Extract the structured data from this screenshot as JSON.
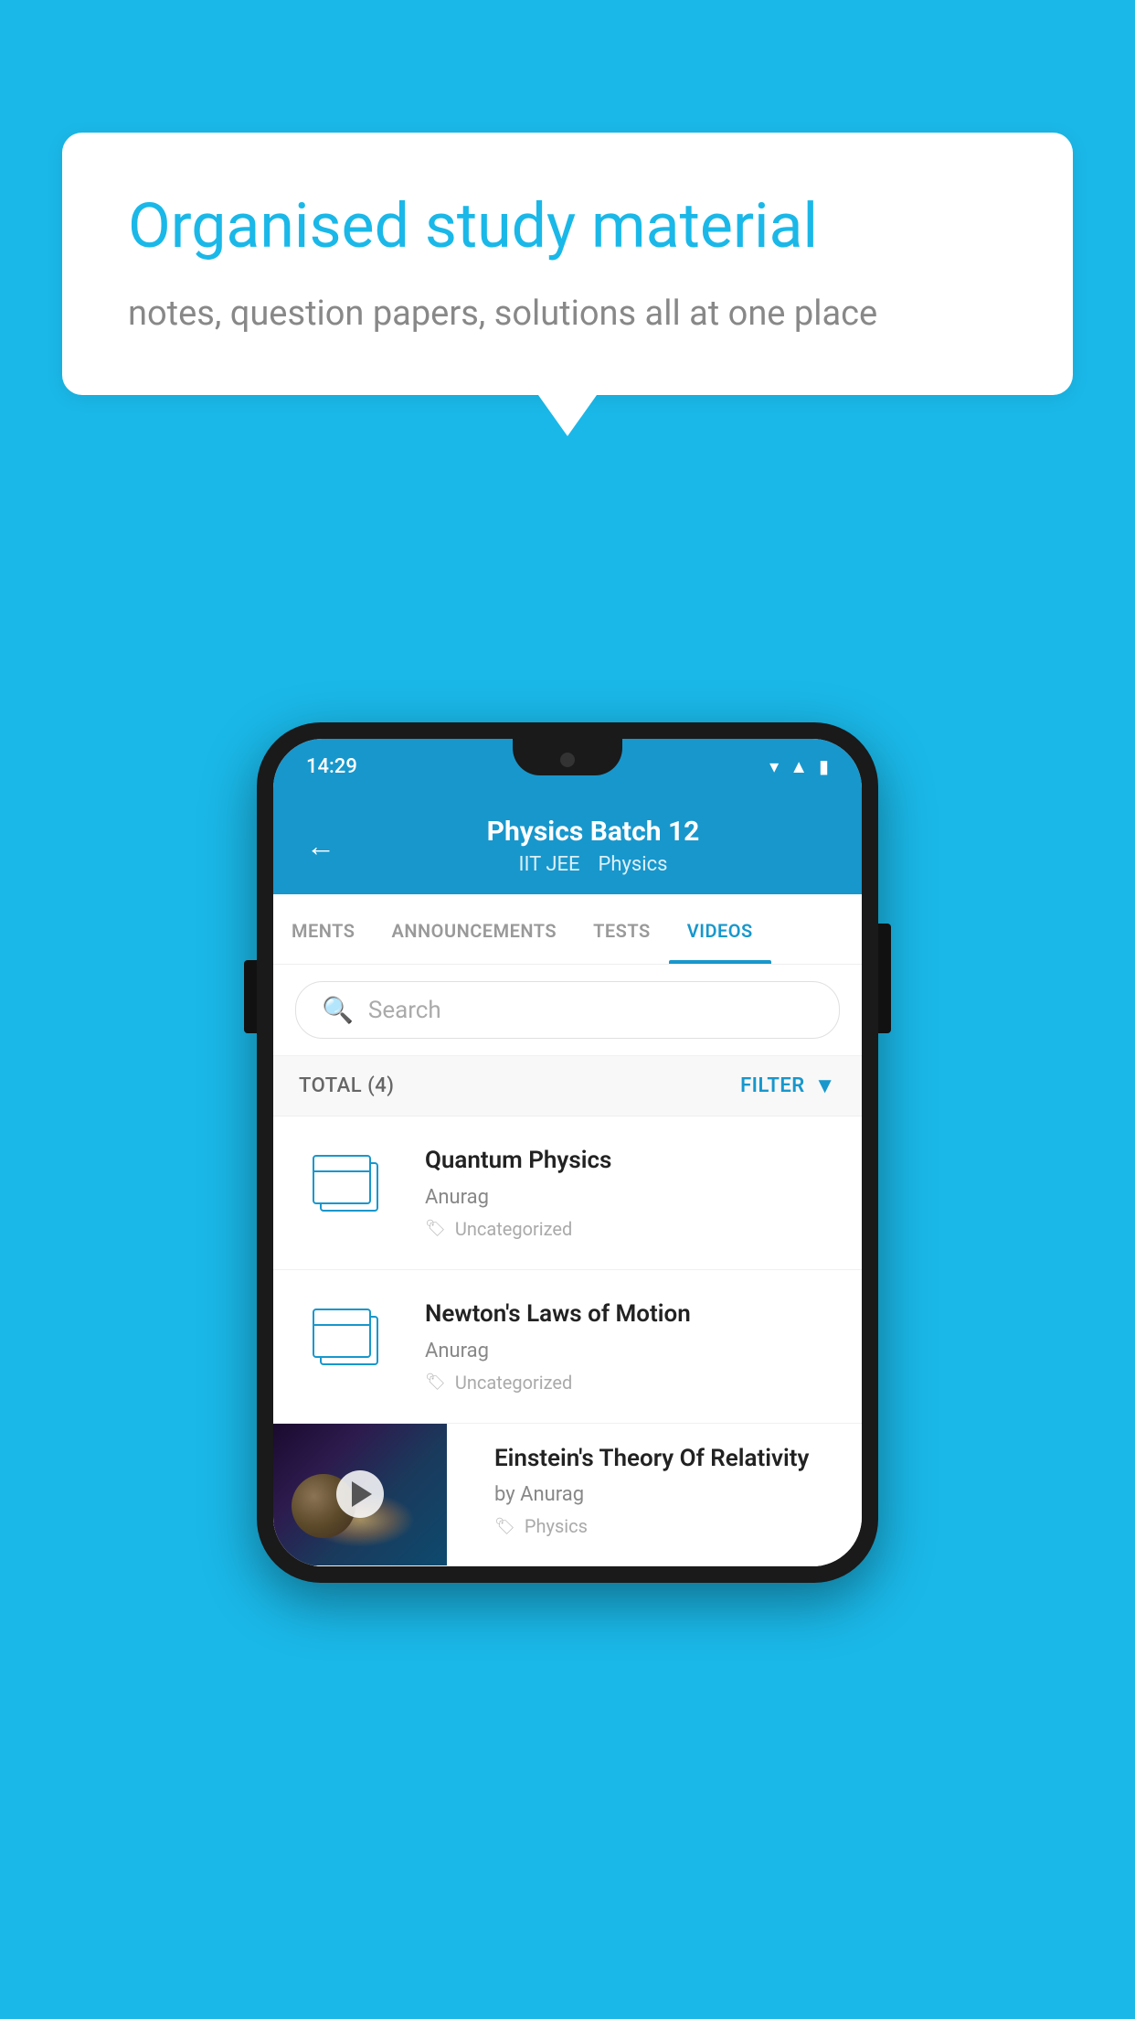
{
  "background_color": "#1ab8e8",
  "speech_bubble": {
    "title": "Organised study material",
    "subtitle": "notes, question papers, solutions all at one place"
  },
  "phone": {
    "status_bar": {
      "time": "14:29"
    },
    "header": {
      "back_label": "←",
      "title": "Physics Batch 12",
      "tag1": "IIT JEE",
      "tag2": "Physics"
    },
    "tabs": [
      {
        "label": "MENTS",
        "active": false
      },
      {
        "label": "ANNOUNCEMENTS",
        "active": false
      },
      {
        "label": "TESTS",
        "active": false
      },
      {
        "label": "VIDEOS",
        "active": true
      }
    ],
    "search": {
      "placeholder": "Search"
    },
    "filter_bar": {
      "total_label": "TOTAL (4)",
      "filter_label": "FILTER"
    },
    "videos": [
      {
        "id": 1,
        "title": "Quantum Physics",
        "author": "Anurag",
        "tag": "Uncategorized",
        "has_thumbnail": false
      },
      {
        "id": 2,
        "title": "Newton's Laws of Motion",
        "author": "Anurag",
        "tag": "Uncategorized",
        "has_thumbnail": false
      },
      {
        "id": 3,
        "title": "Einstein's Theory Of Relativity",
        "author": "by Anurag",
        "tag": "Physics",
        "has_thumbnail": true
      }
    ]
  }
}
